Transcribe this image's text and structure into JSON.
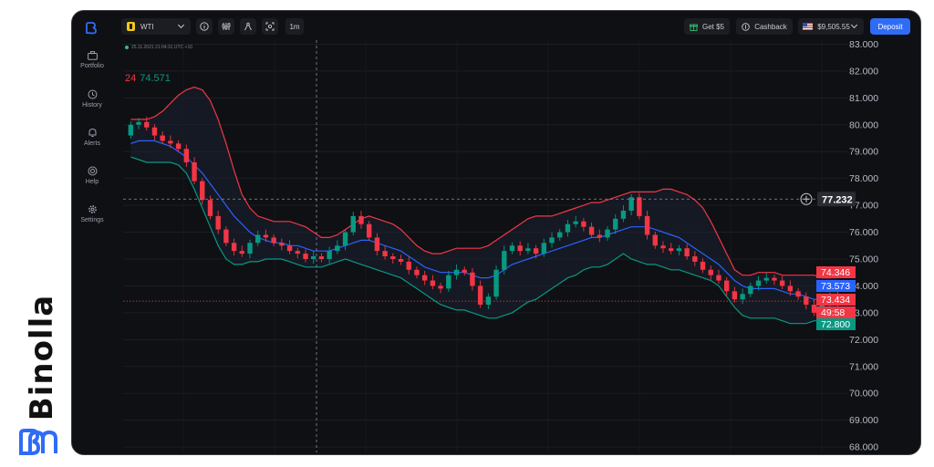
{
  "brand": {
    "name": "Binolla",
    "color": "#2f6cf6"
  },
  "sidebar": {
    "items": [
      {
        "label": "Portfolio",
        "icon": "briefcase-icon"
      },
      {
        "label": "History",
        "icon": "history-icon"
      },
      {
        "label": "Alerts",
        "icon": "bell-icon"
      },
      {
        "label": "Help",
        "icon": "lifebuoy-icon"
      },
      {
        "label": "Settings",
        "icon": "gear-icon"
      }
    ]
  },
  "topbar": {
    "asset": "WTI",
    "timeframe": "1m",
    "get_bonus": "Get $5",
    "cashback": "Cashback",
    "balance": "$9,505.55",
    "deposit": "Deposit"
  },
  "chart_info": {
    "datetime": "25.11.2021 21:04:31 UTC +10",
    "indicator_prefix": "24",
    "indicator_value": "74.571"
  },
  "chart_data": {
    "type": "candlestick",
    "symbol": "WTI",
    "timeframe": "1m",
    "y_ticks": [
      "83.000",
      "82.000",
      "81.000",
      "80.000",
      "79.000",
      "78.000",
      "77.000",
      "76.000",
      "75.000",
      "74.000",
      "73.000",
      "72.000",
      "71.000",
      "70.000",
      "69.000",
      "68.000"
    ],
    "ylim": [
      67.8,
      83.15
    ],
    "crosshair_price": "77.232",
    "price_labels": [
      {
        "value": "74.346",
        "role": "bollinger-upper",
        "color": "#f23645"
      },
      {
        "value": "73.573",
        "role": "bollinger-middle",
        "color": "#2962ff"
      },
      {
        "value": "73.434",
        "role": "current-price",
        "color": "#f23645"
      },
      {
        "value": "49:58",
        "role": "countdown",
        "color": "#f23645"
      },
      {
        "value": "72.800",
        "role": "bollinger-lower",
        "color": "#089981"
      }
    ],
    "close": [
      80.0,
      80.1,
      79.9,
      79.6,
      79.4,
      79.3,
      79.1,
      78.6,
      77.9,
      77.2,
      76.6,
      76.1,
      75.6,
      75.3,
      75.2,
      75.6,
      75.9,
      75.8,
      75.6,
      75.5,
      75.3,
      75.2,
      75.0,
      75.1,
      75.0,
      75.3,
      75.5,
      76.0,
      76.6,
      76.3,
      75.8,
      75.3,
      75.1,
      75.0,
      74.9,
      74.6,
      74.4,
      74.2,
      74.0,
      73.9,
      74.4,
      74.6,
      74.5,
      74.0,
      73.3,
      73.6,
      74.6,
      75.3,
      75.5,
      75.3,
      75.4,
      75.2,
      75.6,
      75.8,
      76.0,
      76.3,
      76.4,
      76.2,
      75.9,
      75.8,
      76.1,
      76.5,
      76.8,
      77.3,
      76.6,
      75.9,
      75.5,
      75.4,
      75.3,
      75.4,
      75.1,
      74.9,
      74.6,
      74.4,
      74.2,
      73.8,
      73.5,
      73.7,
      74.0,
      74.2,
      74.3,
      74.2,
      74.0,
      73.8,
      73.6,
      73.3,
      73.0,
      73.3,
      73.6,
      73.4
    ],
    "open": [
      79.6,
      80.0,
      80.1,
      79.9,
      79.6,
      79.4,
      79.3,
      79.1,
      78.6,
      77.9,
      77.2,
      76.6,
      76.1,
      75.6,
      75.3,
      75.2,
      75.6,
      75.9,
      75.8,
      75.6,
      75.5,
      75.3,
      75.2,
      75.0,
      75.1,
      75.0,
      75.3,
      75.5,
      76.0,
      76.6,
      76.3,
      75.8,
      75.3,
      75.1,
      75.0,
      74.9,
      74.6,
      74.4,
      74.2,
      74.0,
      73.9,
      74.4,
      74.6,
      74.5,
      74.0,
      73.3,
      73.6,
      74.6,
      75.3,
      75.5,
      75.3,
      75.4,
      75.2,
      75.6,
      75.8,
      76.0,
      76.3,
      76.4,
      76.2,
      75.9,
      75.8,
      76.1,
      76.5,
      76.8,
      77.3,
      76.6,
      75.9,
      75.5,
      75.4,
      75.3,
      75.4,
      75.1,
      74.9,
      74.6,
      74.4,
      74.2,
      73.8,
      73.5,
      73.7,
      74.0,
      74.2,
      74.3,
      74.2,
      74.0,
      73.8,
      73.6,
      73.3,
      73.0,
      73.3,
      73.6
    ],
    "bollinger_upper": [
      80.2,
      80.2,
      80.2,
      80.3,
      80.5,
      80.8,
      81.1,
      81.3,
      81.4,
      81.3,
      80.9,
      80.2,
      79.3,
      78.3,
      77.4,
      76.9,
      76.6,
      76.5,
      76.4,
      76.4,
      76.4,
      76.3,
      76.2,
      76.0,
      75.8,
      75.8,
      75.9,
      76.1,
      76.3,
      76.5,
      76.6,
      76.5,
      76.4,
      76.3,
      76.1,
      75.8,
      75.5,
      75.3,
      75.2,
      75.2,
      75.3,
      75.4,
      75.4,
      75.4,
      75.4,
      75.5,
      75.7,
      75.9,
      76.1,
      76.3,
      76.5,
      76.6,
      76.6,
      76.6,
      76.7,
      76.8,
      76.9,
      77.0,
      77.1,
      77.1,
      77.2,
      77.3,
      77.4,
      77.5,
      77.5,
      77.5,
      77.5,
      77.6,
      77.6,
      77.5,
      77.4,
      77.2,
      76.9,
      76.4,
      75.8,
      75.2,
      74.6,
      74.4,
      74.4,
      74.5,
      74.5,
      74.5,
      74.4,
      74.4,
      74.4,
      74.4,
      74.4,
      74.3,
      74.3,
      74.35
    ],
    "bollinger_middle": [
      79.3,
      79.4,
      79.4,
      79.4,
      79.3,
      79.2,
      79.0,
      78.8,
      78.5,
      78.2,
      77.8,
      77.4,
      77.0,
      76.6,
      76.3,
      76.0,
      75.8,
      75.7,
      75.6,
      75.6,
      75.5,
      75.5,
      75.4,
      75.3,
      75.3,
      75.3,
      75.4,
      75.5,
      75.6,
      75.7,
      75.7,
      75.6,
      75.5,
      75.4,
      75.3,
      75.1,
      74.9,
      74.7,
      74.6,
      74.5,
      74.5,
      74.5,
      74.5,
      74.4,
      74.3,
      74.3,
      74.4,
      74.6,
      74.8,
      74.9,
      75.0,
      75.1,
      75.2,
      75.3,
      75.4,
      75.5,
      75.6,
      75.7,
      75.8,
      75.8,
      75.9,
      76.0,
      76.1,
      76.2,
      76.2,
      76.2,
      76.1,
      76.0,
      75.9,
      75.8,
      75.6,
      75.4,
      75.2,
      75.0,
      74.8,
      74.5,
      74.2,
      74.0,
      73.9,
      73.9,
      73.9,
      73.9,
      73.8,
      73.7,
      73.7,
      73.6,
      73.5,
      73.5,
      73.6,
      73.57
    ],
    "bollinger_lower": [
      78.8,
      78.7,
      78.6,
      78.6,
      78.6,
      78.6,
      78.5,
      78.2,
      77.6,
      76.9,
      76.2,
      75.5,
      75.0,
      74.8,
      74.8,
      74.9,
      74.9,
      75.0,
      75.0,
      75.0,
      74.9,
      74.8,
      74.7,
      74.7,
      74.7,
      74.8,
      74.9,
      75.0,
      74.9,
      74.8,
      74.7,
      74.6,
      74.5,
      74.4,
      74.3,
      74.1,
      73.9,
      73.7,
      73.5,
      73.3,
      73.2,
      73.1,
      73.1,
      73.0,
      72.9,
      72.8,
      72.8,
      72.9,
      73.0,
      73.2,
      73.4,
      73.5,
      73.7,
      73.9,
      74.1,
      74.3,
      74.4,
      74.6,
      74.7,
      74.7,
      74.8,
      75.0,
      75.2,
      75.0,
      74.9,
      74.8,
      74.8,
      74.7,
      74.6,
      74.6,
      74.5,
      74.4,
      74.3,
      74.2,
      74.0,
      73.6,
      73.2,
      72.9,
      72.8,
      72.8,
      72.8,
      72.8,
      72.7,
      72.6,
      72.6,
      72.6,
      72.7,
      72.7,
      72.75,
      72.8
    ]
  },
  "colors": {
    "up": "#089981",
    "down": "#f23645",
    "upper": "#f23645",
    "middle": "#2962ff",
    "lower": "#089981"
  }
}
